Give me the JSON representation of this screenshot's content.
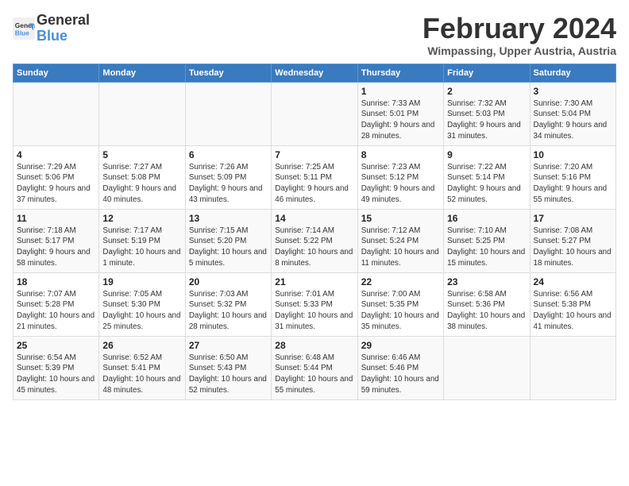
{
  "header": {
    "logo_line1": "General",
    "logo_line2": "Blue",
    "month_title": "February 2024",
    "subtitle": "Wimpassing, Upper Austria, Austria"
  },
  "weekdays": [
    "Sunday",
    "Monday",
    "Tuesday",
    "Wednesday",
    "Thursday",
    "Friday",
    "Saturday"
  ],
  "weeks": [
    [
      {
        "day": "",
        "info": ""
      },
      {
        "day": "",
        "info": ""
      },
      {
        "day": "",
        "info": ""
      },
      {
        "day": "",
        "info": ""
      },
      {
        "day": "1",
        "info": "Sunrise: 7:33 AM\nSunset: 5:01 PM\nDaylight: 9 hours and 28 minutes."
      },
      {
        "day": "2",
        "info": "Sunrise: 7:32 AM\nSunset: 5:03 PM\nDaylight: 9 hours and 31 minutes."
      },
      {
        "day": "3",
        "info": "Sunrise: 7:30 AM\nSunset: 5:04 PM\nDaylight: 9 hours and 34 minutes."
      }
    ],
    [
      {
        "day": "4",
        "info": "Sunrise: 7:29 AM\nSunset: 5:06 PM\nDaylight: 9 hours and 37 minutes."
      },
      {
        "day": "5",
        "info": "Sunrise: 7:27 AM\nSunset: 5:08 PM\nDaylight: 9 hours and 40 minutes."
      },
      {
        "day": "6",
        "info": "Sunrise: 7:26 AM\nSunset: 5:09 PM\nDaylight: 9 hours and 43 minutes."
      },
      {
        "day": "7",
        "info": "Sunrise: 7:25 AM\nSunset: 5:11 PM\nDaylight: 9 hours and 46 minutes."
      },
      {
        "day": "8",
        "info": "Sunrise: 7:23 AM\nSunset: 5:12 PM\nDaylight: 9 hours and 49 minutes."
      },
      {
        "day": "9",
        "info": "Sunrise: 7:22 AM\nSunset: 5:14 PM\nDaylight: 9 hours and 52 minutes."
      },
      {
        "day": "10",
        "info": "Sunrise: 7:20 AM\nSunset: 5:16 PM\nDaylight: 9 hours and 55 minutes."
      }
    ],
    [
      {
        "day": "11",
        "info": "Sunrise: 7:18 AM\nSunset: 5:17 PM\nDaylight: 9 hours and 58 minutes."
      },
      {
        "day": "12",
        "info": "Sunrise: 7:17 AM\nSunset: 5:19 PM\nDaylight: 10 hours and 1 minute."
      },
      {
        "day": "13",
        "info": "Sunrise: 7:15 AM\nSunset: 5:20 PM\nDaylight: 10 hours and 5 minutes."
      },
      {
        "day": "14",
        "info": "Sunrise: 7:14 AM\nSunset: 5:22 PM\nDaylight: 10 hours and 8 minutes."
      },
      {
        "day": "15",
        "info": "Sunrise: 7:12 AM\nSunset: 5:24 PM\nDaylight: 10 hours and 11 minutes."
      },
      {
        "day": "16",
        "info": "Sunrise: 7:10 AM\nSunset: 5:25 PM\nDaylight: 10 hours and 15 minutes."
      },
      {
        "day": "17",
        "info": "Sunrise: 7:08 AM\nSunset: 5:27 PM\nDaylight: 10 hours and 18 minutes."
      }
    ],
    [
      {
        "day": "18",
        "info": "Sunrise: 7:07 AM\nSunset: 5:28 PM\nDaylight: 10 hours and 21 minutes."
      },
      {
        "day": "19",
        "info": "Sunrise: 7:05 AM\nSunset: 5:30 PM\nDaylight: 10 hours and 25 minutes."
      },
      {
        "day": "20",
        "info": "Sunrise: 7:03 AM\nSunset: 5:32 PM\nDaylight: 10 hours and 28 minutes."
      },
      {
        "day": "21",
        "info": "Sunrise: 7:01 AM\nSunset: 5:33 PM\nDaylight: 10 hours and 31 minutes."
      },
      {
        "day": "22",
        "info": "Sunrise: 7:00 AM\nSunset: 5:35 PM\nDaylight: 10 hours and 35 minutes."
      },
      {
        "day": "23",
        "info": "Sunrise: 6:58 AM\nSunset: 5:36 PM\nDaylight: 10 hours and 38 minutes."
      },
      {
        "day": "24",
        "info": "Sunrise: 6:56 AM\nSunset: 5:38 PM\nDaylight: 10 hours and 41 minutes."
      }
    ],
    [
      {
        "day": "25",
        "info": "Sunrise: 6:54 AM\nSunset: 5:39 PM\nDaylight: 10 hours and 45 minutes."
      },
      {
        "day": "26",
        "info": "Sunrise: 6:52 AM\nSunset: 5:41 PM\nDaylight: 10 hours and 48 minutes."
      },
      {
        "day": "27",
        "info": "Sunrise: 6:50 AM\nSunset: 5:43 PM\nDaylight: 10 hours and 52 minutes."
      },
      {
        "day": "28",
        "info": "Sunrise: 6:48 AM\nSunset: 5:44 PM\nDaylight: 10 hours and 55 minutes."
      },
      {
        "day": "29",
        "info": "Sunrise: 6:46 AM\nSunset: 5:46 PM\nDaylight: 10 hours and 59 minutes."
      },
      {
        "day": "",
        "info": ""
      },
      {
        "day": "",
        "info": ""
      }
    ]
  ]
}
